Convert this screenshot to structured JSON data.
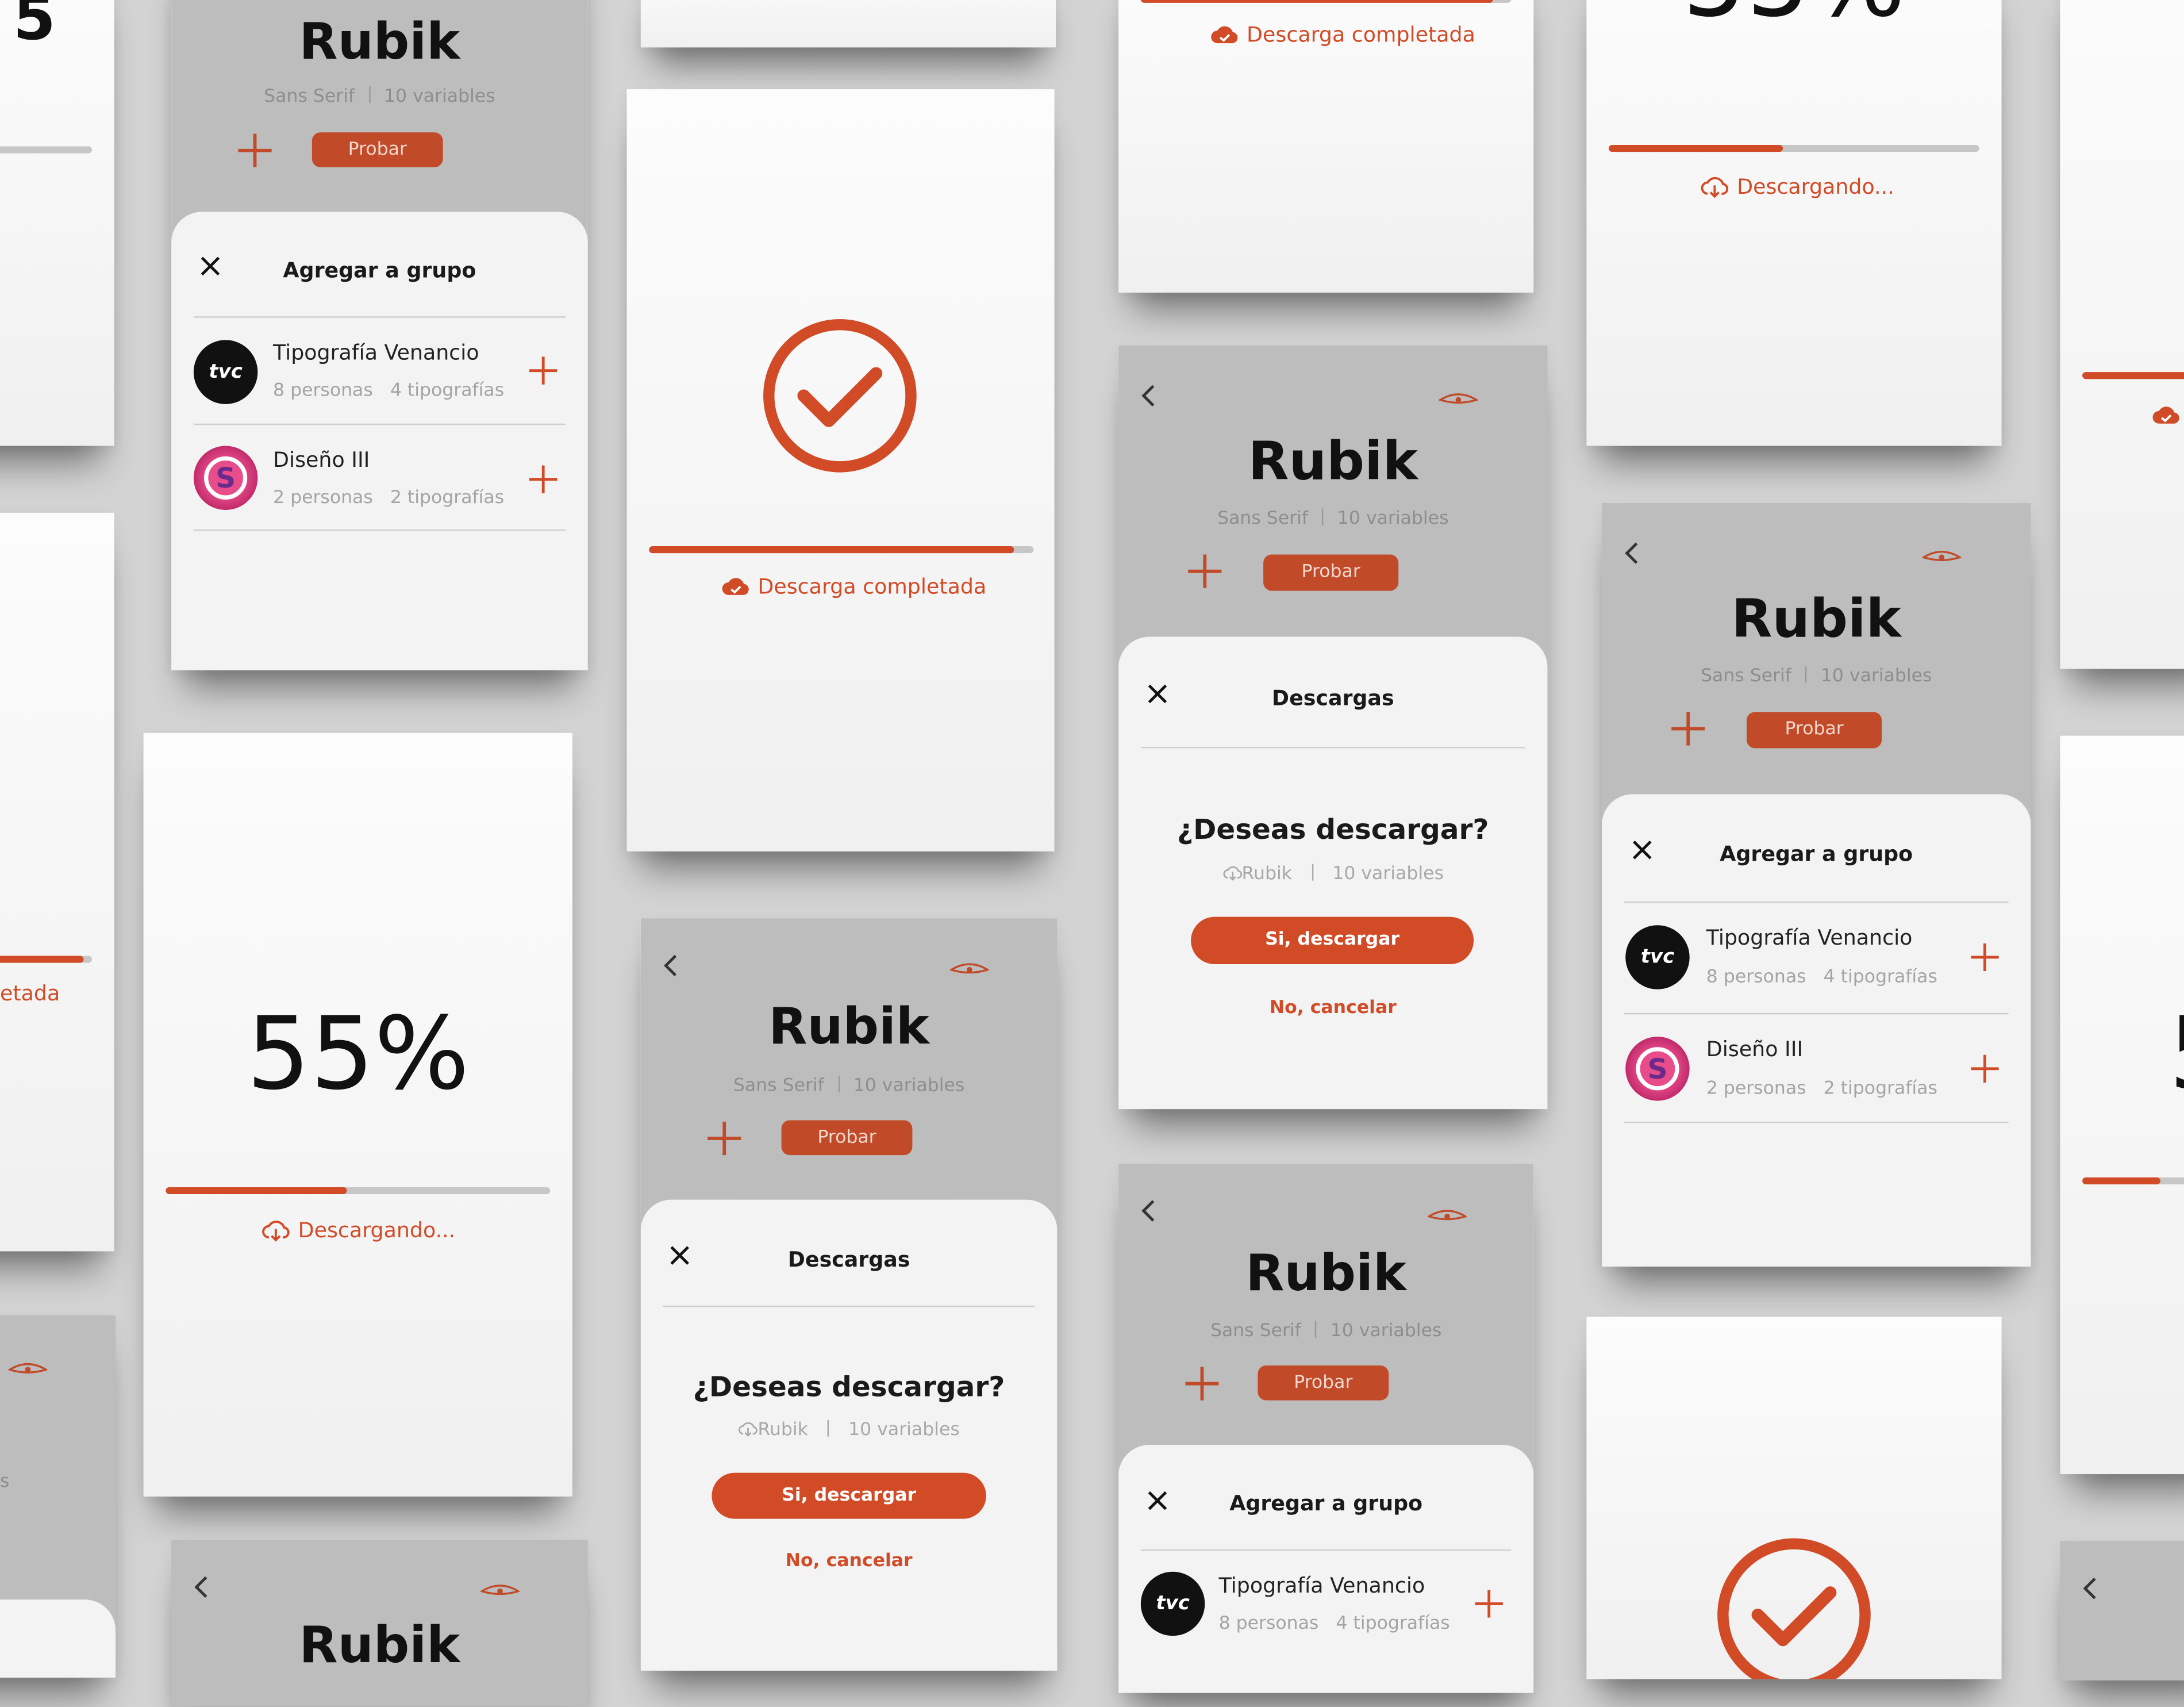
{
  "accent": "#d24b27",
  "font": {
    "name": "Rubik",
    "category": "Sans Serif",
    "variables": "10 variables",
    "try_label": "Probar"
  },
  "add_group": {
    "title": "Agregar a grupo",
    "groups": [
      {
        "name": "Tipografía Venancio",
        "people": "8 personas",
        "fonts": "4 tipografías",
        "avatar": "tvc"
      },
      {
        "name": "Diseño III",
        "people": "2 personas",
        "fonts": "2 tipografías",
        "avatar": "S"
      }
    ]
  },
  "downloads": {
    "title": "Descargas",
    "question": "¿Deseas descargar?",
    "font_name": "Rubik",
    "variables": "10 variables",
    "confirm_label": "Si, descargar",
    "cancel_label": "No, cancelar"
  },
  "progress": {
    "percent_label": "55%",
    "percent": 0.47,
    "downloading_label": "Descargando...",
    "completed_label": "Descarga completada",
    "completed_fraction": 0.95
  },
  "partial": {
    "completed_suffix": "etada",
    "variables_suffix": "s",
    "digit": "5"
  },
  "icons": [
    "back-icon",
    "eye-icon",
    "plus-icon",
    "close-icon",
    "cloud-download-icon",
    "cloud-done-icon",
    "check-circle-icon"
  ]
}
